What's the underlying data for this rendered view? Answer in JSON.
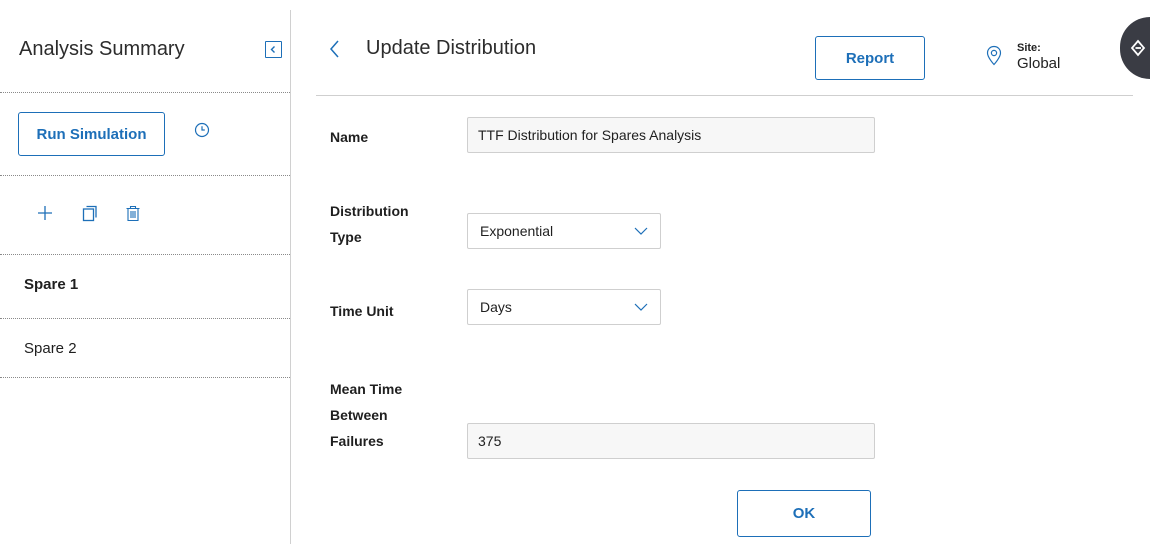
{
  "sidebar": {
    "title": "Analysis Summary",
    "run_simulation_label": "Run Simulation",
    "items": [
      {
        "label": "Spare 1",
        "selected": true
      },
      {
        "label": "Spare 2",
        "selected": false
      }
    ]
  },
  "header": {
    "title": "Update Distribution",
    "report_label": "Report",
    "site_label": "Site:",
    "site_value": "Global"
  },
  "form": {
    "name_label": "Name",
    "name_value": "TTF Distribution for Spares Analysis",
    "distribution_type_label_line1": "Distribution",
    "distribution_type_label_line2": "Type",
    "distribution_type_value": "Exponential",
    "time_unit_label": "Time Unit",
    "time_unit_value": "Days",
    "mtbf_label_line1": "Mean Time",
    "mtbf_label_line2": "Between",
    "mtbf_label_line3": "Failures",
    "mtbf_value": "375",
    "ok_label": "OK"
  },
  "colors": {
    "accent": "#1d6fb8",
    "assistant_tab": "#3a3c44"
  }
}
